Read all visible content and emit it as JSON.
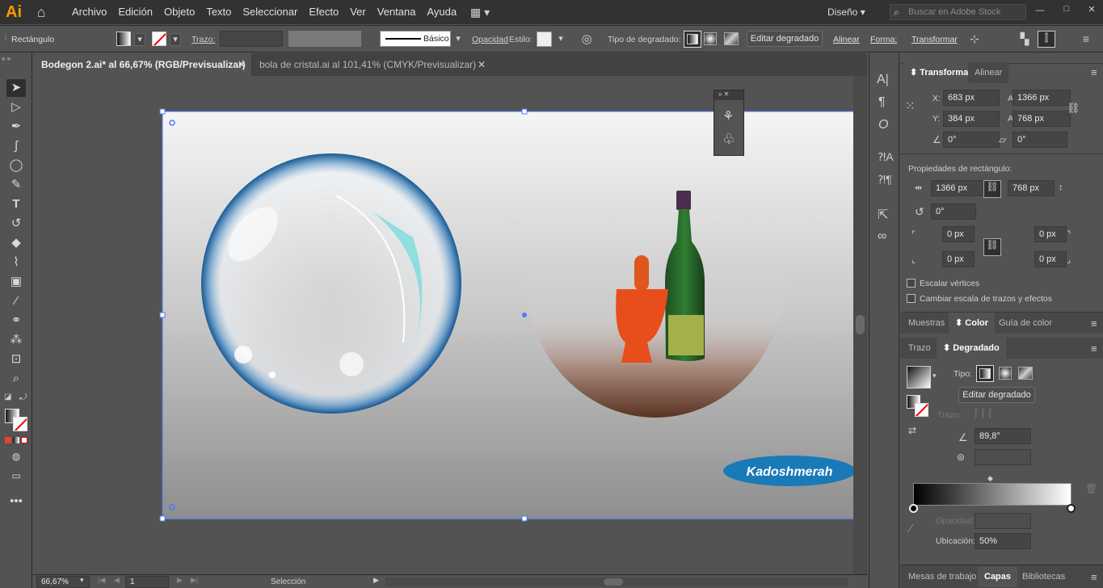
{
  "app": {
    "logo": "Ai"
  },
  "menu": [
    "Archivo",
    "Edición",
    "Objeto",
    "Texto",
    "Seleccionar",
    "Efecto",
    "Ver",
    "Ventana",
    "Ayuda"
  ],
  "workspace": "Diseño",
  "search_placeholder": "Buscar en Adobe Stock",
  "control": {
    "selection_type": "Rectángulo",
    "stroke_label": "Trazo:",
    "brush_label": "Básico",
    "opacity_label": "Opacidad",
    "style_label": "Estilo:",
    "gradient_type_label": "Tipo de degradado:",
    "edit_gradient_label": "Editar degradado",
    "align_label": "Alinear",
    "shape_label": "Forma:",
    "transform_label": "Transformar"
  },
  "tabs": [
    {
      "label": "Bodegon 2.ai* al 66,67% (RGB/Previsualizar)",
      "active": true
    },
    {
      "label": "bola de cristal.ai al 101,41% (CMYK/Previsualizar)",
      "active": false
    }
  ],
  "artwork": {
    "watermark": "Kadoshmerah"
  },
  "transform_panel": {
    "tab_active": "Transformar",
    "tab_other": "Alinear",
    "x_label": "X:",
    "x": "683 px",
    "y_label": "Y:",
    "y": "384 px",
    "w_label": "An.:",
    "w": "1366 px",
    "h_label": "Al.:",
    "h": "768 px",
    "angle": "0°",
    "shear": "0°",
    "rect_props_label": "Propiedades de rectángulo:",
    "rect_w": "1366 px",
    "rect_h": "768 px",
    "rect_angle": "0°",
    "corner_tl": "0 px",
    "corner_tr": "0 px",
    "corner_bl": "0 px",
    "corner_br": "0 px",
    "scale_corners": "Escalar vértices",
    "scale_strokes": "Cambiar escala de trazos y efectos"
  },
  "color_tabs": [
    "Muestras",
    "Color",
    "Guía de color"
  ],
  "gradient_tabs": [
    "Trazo",
    "Degradado"
  ],
  "gradient_panel": {
    "type_label": "Tipo:",
    "edit_label": "Editar degradado",
    "stroke_label": "Trazo:",
    "angle": "89,8°",
    "opacity_label": "Opacidad:",
    "location_label": "Ubicación:",
    "location": "50%"
  },
  "bottom_tabs": [
    "Mesas de trabajo",
    "Capas",
    "Bibliotecas"
  ],
  "status": {
    "zoom": "66,67%",
    "artboard": "1",
    "tool": "Selección"
  }
}
